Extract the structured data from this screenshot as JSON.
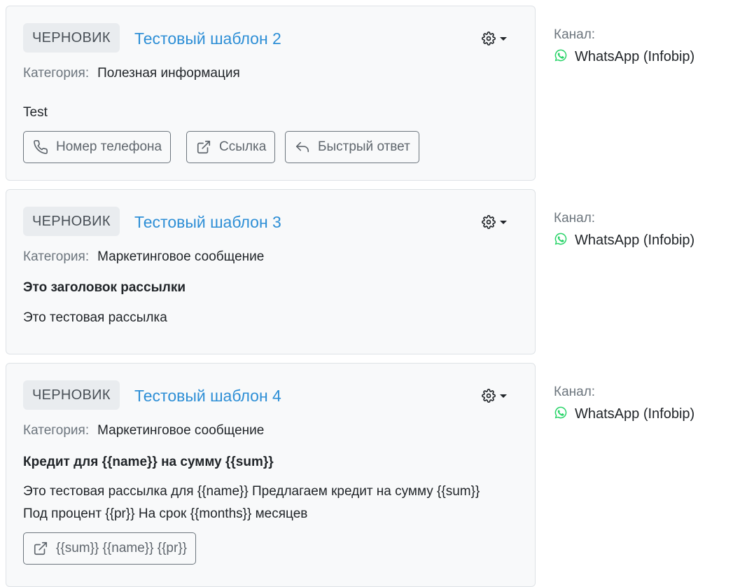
{
  "cards": [
    {
      "badge": "ЧЕРНОВИК",
      "title": "Тестовый шаблон 2",
      "category_label": "Категория:",
      "category_value": "Полезная информация",
      "body": "Test",
      "buttons": [
        {
          "label": "Номер телефона",
          "icon": "phone-icon"
        },
        {
          "label": "Ссылка",
          "icon": "external-link-icon"
        },
        {
          "label": "Быстрый ответ",
          "icon": "reply-icon"
        }
      ],
      "channel_label": "Канал:",
      "channel_name": "WhatsApp (Infobip)"
    },
    {
      "badge": "ЧЕРНОВИК",
      "title": "Тестовый шаблон 3",
      "category_label": "Категория:",
      "category_value": "Маркетинговое сообщение",
      "heading": "Это заголовок рассылки",
      "body": "Это тестовая рассылка",
      "channel_label": "Канал:",
      "channel_name": "WhatsApp (Infobip)"
    },
    {
      "badge": "ЧЕРНОВИК",
      "title": "Тестовый шаблон 4",
      "category_label": "Категория:",
      "category_value": "Маркетинговое сообщение",
      "heading": "Кредит для {{name}} на сумму {{sum}}",
      "body_line1": "Это тестовая рассылка для {{name}} Предлагаем кредит на сумму {{sum}}",
      "body_line2": "Под процент {{pr}} На срок {{months}} месяцев",
      "buttons": [
        {
          "label": "{{sum}} {{name}} {{pr}}",
          "icon": "external-link-icon"
        }
      ],
      "channel_label": "Канал:",
      "channel_name": "WhatsApp (Infobip)"
    }
  ],
  "colors": {
    "link": "#2e8fd6",
    "whatsapp": "#25d366",
    "card_bg": "#f8f9fa",
    "badge_bg": "#e9ecef"
  }
}
